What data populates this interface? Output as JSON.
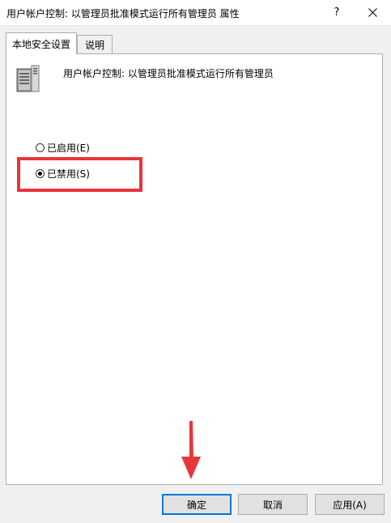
{
  "window": {
    "title": "用户帐户控制: 以管理员批准模式运行所有管理员 属性",
    "help_label": "?",
    "close_icon": "close-icon"
  },
  "tabs": [
    {
      "label": "本地安全设置",
      "active": true
    },
    {
      "label": "说明",
      "active": false
    }
  ],
  "policy": {
    "icon": "server-policy-icon",
    "name": "用户帐户控制: 以管理员批准模式运行所有管理员"
  },
  "options": [
    {
      "label": "已启用(E)",
      "checked": false
    },
    {
      "label": "已禁用(S)",
      "checked": true
    }
  ],
  "annotations": {
    "highlight_color": "#e8353a",
    "arrow_color": "#e8353a"
  },
  "buttons": {
    "ok": "确定",
    "cancel": "取消",
    "apply": "应用(A)"
  }
}
